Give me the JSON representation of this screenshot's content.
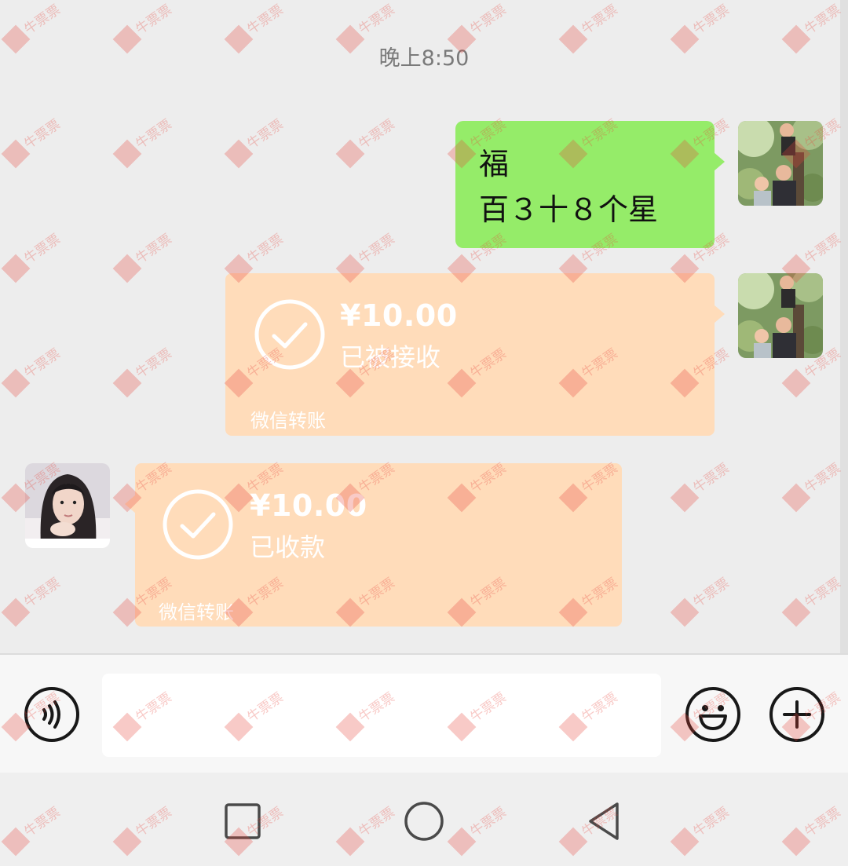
{
  "chat": {
    "timestamp": "晚上8:50",
    "text_message": {
      "line1": "福",
      "line2": "百３十８个星"
    },
    "transfer_sent": {
      "amount": "¥10.00",
      "status": "已被接收",
      "footer": "微信转账"
    },
    "transfer_received": {
      "amount": "¥10.00",
      "status": "已收款",
      "footer": "微信转账"
    }
  },
  "colors": {
    "background": "#ededed",
    "bubble_green": "#95ec69",
    "transfer_faded": "#ffdcba"
  },
  "watermark_text": "牛票票",
  "icons": [
    "voice-icon",
    "emoji-icon",
    "plus-icon",
    "nav-square-icon",
    "nav-circle-icon",
    "nav-back-icon",
    "check-circle-icon"
  ]
}
